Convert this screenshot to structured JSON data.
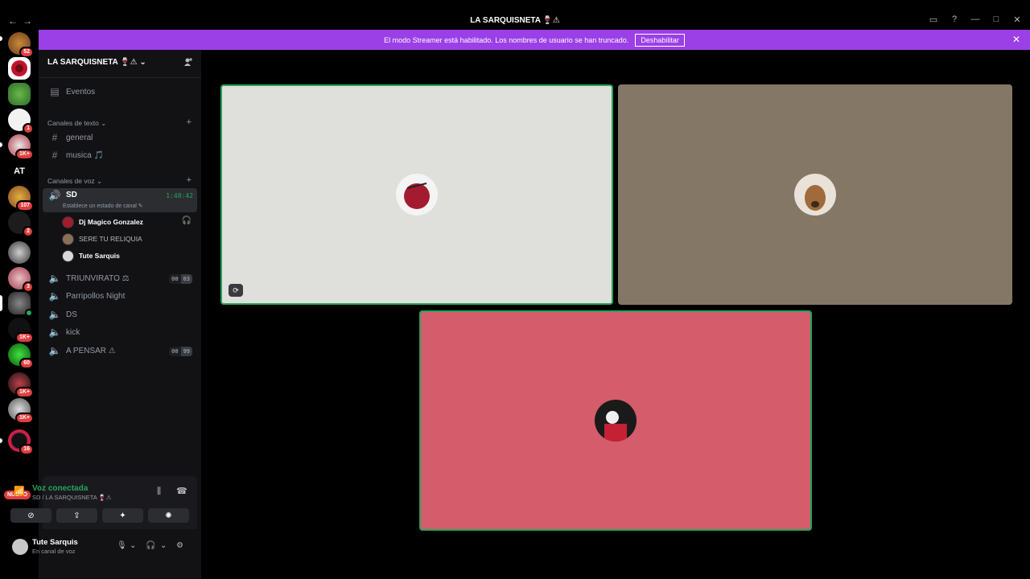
{
  "window": {
    "title": "LA SARQUISNETA 🍷⚠",
    "nav": [
      "←",
      "→"
    ],
    "controls": [
      "inbox-icon",
      "help-icon",
      "minimize",
      "maximize",
      "close"
    ]
  },
  "banner": {
    "text": "El modo Streamer está habilitado. Los nombres de usuario se han truncado.",
    "button": "Deshabilitar"
  },
  "rail": {
    "servers": [
      {
        "badge": "52"
      },
      {
        "badge": ""
      },
      {
        "badge": ""
      },
      {
        "badge": "1"
      },
      {
        "badge": "1K+"
      },
      {
        "label": "AT"
      },
      {
        "badge": "107"
      },
      {
        "badge": "2"
      },
      {
        "badge": ""
      },
      {
        "badge": "3"
      },
      {
        "badge": ""
      },
      {
        "badge": "1K+"
      },
      {
        "badge": "60"
      },
      {
        "badge": "1K+"
      },
      {
        "badge": "1K+"
      },
      {
        "badge": "16"
      }
    ],
    "new_label": "NUEVO"
  },
  "sidebar": {
    "server_name": "LA SARQUISNETA 🍷⚠",
    "events": "Eventos",
    "text_category": "Canales de texto",
    "text_channels": [
      "general",
      "musica 🎵"
    ],
    "voice_category": "Canales de voz",
    "active_voice": {
      "name": "SD",
      "time": "1:48:42",
      "status": "Establece un estado de canal ✎"
    },
    "members": [
      "Dj Magico Gonzalez",
      "SERE TU RELIQUIA",
      "Tute Sarquis"
    ],
    "voice_channels": [
      {
        "name": "TRIUNVIRATO ⚖",
        "counts": [
          "00",
          "03"
        ]
      },
      {
        "name": "Parripollos Night"
      },
      {
        "name": "DS"
      },
      {
        "name": "kick"
      },
      {
        "name": "A PENSAR ⚠",
        "counts": [
          "00",
          "99"
        ]
      }
    ]
  },
  "voice_panel": {
    "status": "Voz conectada",
    "location": "SD / LA SARQUISNETA 🍷⚠"
  },
  "user": {
    "name": "Tute Sarquis",
    "status": "En canal de voz"
  },
  "colors": {
    "accent_green": "#23a55a",
    "banner_purple": "#9b3fe7",
    "badge_red": "#e03e3e",
    "tile1_bg": "#dfdfdb",
    "tile2_bg": "#857766",
    "tile3_bg": "#d45c6b"
  }
}
